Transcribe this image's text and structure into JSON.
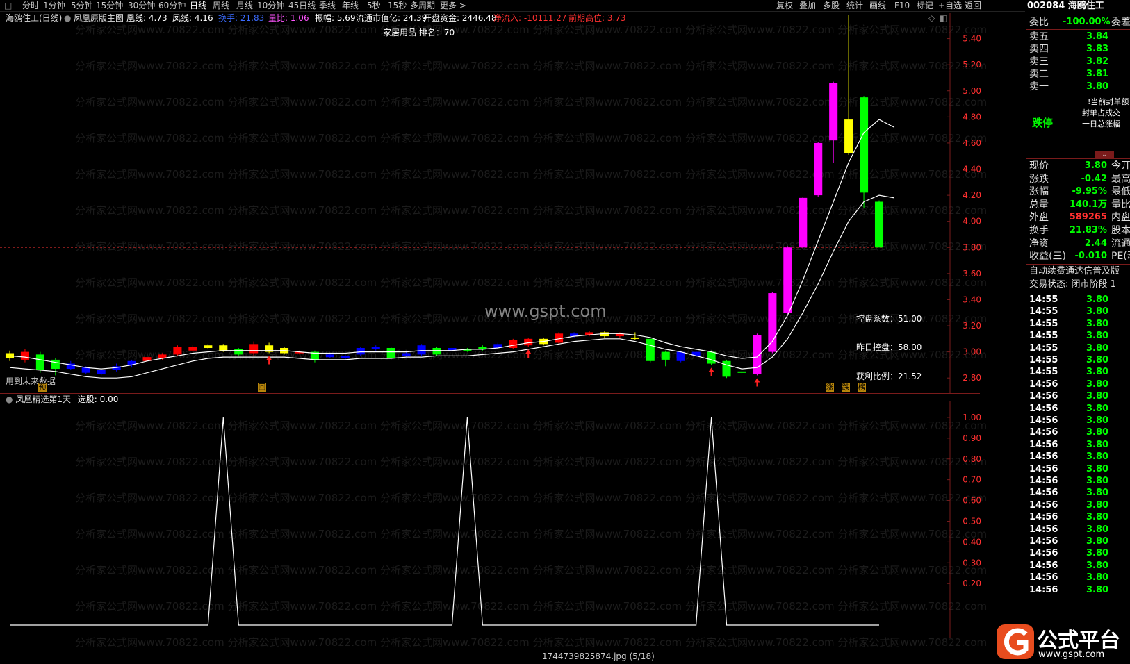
{
  "menubar": {
    "items": [
      "分时",
      "1分钟",
      "5分钟",
      "15分钟",
      "30分钟",
      "60分钟",
      "日线",
      "周线",
      "月线",
      "10分钟",
      "45日线",
      "季线",
      "年线",
      "5秒",
      "15秒",
      "多周期",
      "更多 >"
    ],
    "active_index": 6,
    "right_items": [
      "复权",
      "叠加",
      "多股",
      "统计",
      "画线",
      "F10",
      "标记",
      "+自选",
      "返回"
    ],
    "code_title": "002084 海鸥住工"
  },
  "infobar": {
    "stock_period": "海鸥住工(日线)",
    "indicator_name": "凤凰原版主图",
    "huang_line": "凰线: 4.73",
    "feng_line": "凤线: 4.16",
    "turnover": "换手: 21.83",
    "vol_ratio": "量比: 1.06",
    "amplitude": "振幅: 5.69",
    "float_mv": "流通市值亿: 24.39",
    "open_funds": "开盘资金: 2446.48",
    "net_inflow": "净流入: -10111.27",
    "prev_high": "前期高位: 3.73"
  },
  "main": {
    "sector_rank": "家居用品 排名：70",
    "watermark_row": "分析家公式网www.70822.com 分析家公式网www.70822.com 分析家公式网www.70822.com 分析家公式网www.70822.com 分析家公式网www.70822.com 分析家公式网www.70822.com",
    "watermark_center": "www.gspt.com",
    "control_coef": "控盘系数：51.00",
    "yesterday_control": "昨日控盘：58.00",
    "profit_ratio": "获利比例：21.52",
    "future_data_note": "用到未来数据",
    "marker_yu": "预",
    "marker_hui": "回",
    "marker_zhang": "涨",
    "marker_die": "跌",
    "marker_bang": "榜"
  },
  "sub": {
    "indicator_name": "凤凰精选第1天",
    "select_value": "选股: 0.00"
  },
  "chart_data": [
    {
      "type": "candlestick",
      "title": "",
      "y_ticks": [
        "5.40",
        "5.20",
        "5.00",
        "4.80",
        "4.60",
        "4.40",
        "4.20",
        "4.00",
        "3.80",
        "3.60",
        "3.40",
        "3.20",
        "3.00",
        "2.80"
      ],
      "ylim": [
        2.7,
        5.6
      ],
      "reference_line": 3.8,
      "candles": [
        {
          "o": 2.95,
          "c": 2.99,
          "h": 3.01,
          "l": 2.93,
          "color": "#ffff00"
        },
        {
          "o": 3.0,
          "c": 2.94,
          "h": 3.02,
          "l": 2.92,
          "color": "#ff0000"
        },
        {
          "o": 2.98,
          "c": 2.86,
          "h": 3.0,
          "l": 2.84,
          "color": "#00ff00"
        },
        {
          "o": 2.87,
          "c": 2.94,
          "h": 2.95,
          "l": 2.82,
          "color": "#00ff00"
        },
        {
          "o": 2.91,
          "c": 2.87,
          "h": 2.93,
          "l": 2.86,
          "color": "#0000ff"
        },
        {
          "o": 2.88,
          "c": 2.84,
          "h": 2.89,
          "l": 2.83,
          "color": "#0000ff"
        },
        {
          "o": 2.83,
          "c": 2.86,
          "h": 2.87,
          "l": 2.82,
          "color": "#0000ff"
        },
        {
          "o": 2.86,
          "c": 2.89,
          "h": 2.91,
          "l": 2.85,
          "color": "#0000ff"
        },
        {
          "o": 2.9,
          "c": 2.93,
          "h": 2.94,
          "l": 2.88,
          "color": "#0000ff"
        },
        {
          "o": 2.93,
          "c": 2.96,
          "h": 2.97,
          "l": 2.92,
          "color": "#ff0000"
        },
        {
          "o": 2.95,
          "c": 2.98,
          "h": 2.99,
          "l": 2.94,
          "color": "#ff0000"
        },
        {
          "o": 2.98,
          "c": 3.04,
          "h": 3.05,
          "l": 2.97,
          "color": "#ff0000"
        },
        {
          "o": 3.01,
          "c": 3.04,
          "h": 3.05,
          "l": 3.0,
          "color": "#ff0000"
        },
        {
          "o": 3.03,
          "c": 3.05,
          "h": 3.06,
          "l": 3.02,
          "color": "#ffff00"
        },
        {
          "o": 3.05,
          "c": 3.01,
          "h": 3.06,
          "l": 3.0,
          "color": "#ffff00"
        },
        {
          "o": 3.02,
          "c": 2.98,
          "h": 3.03,
          "l": 2.97,
          "color": "#00ff00"
        },
        {
          "o": 2.99,
          "c": 3.06,
          "h": 3.08,
          "l": 2.97,
          "color": "#ff0000"
        },
        {
          "o": 3.05,
          "c": 3.0,
          "h": 3.07,
          "l": 2.99,
          "color": "#ffff00"
        },
        {
          "o": 3.03,
          "c": 2.99,
          "h": 3.04,
          "l": 2.98,
          "color": "#ffff00"
        },
        {
          "o": 2.99,
          "c": 3.0,
          "h": 3.01,
          "l": 2.98,
          "color": "#ff0000"
        },
        {
          "o": 3.0,
          "c": 2.94,
          "h": 3.01,
          "l": 2.92,
          "color": "#00ff00"
        },
        {
          "o": 2.96,
          "c": 2.98,
          "h": 2.99,
          "l": 2.95,
          "color": "#0000ff"
        },
        {
          "o": 2.97,
          "c": 2.95,
          "h": 2.98,
          "l": 2.94,
          "color": "#0000ff"
        },
        {
          "o": 2.98,
          "c": 3.03,
          "h": 3.04,
          "l": 2.97,
          "color": "#0000ff"
        },
        {
          "o": 3.02,
          "c": 3.04,
          "h": 3.05,
          "l": 3.01,
          "color": "#0000ff"
        },
        {
          "o": 3.03,
          "c": 2.95,
          "h": 3.04,
          "l": 2.94,
          "color": "#00ff00"
        },
        {
          "o": 2.97,
          "c": 2.99,
          "h": 3.0,
          "l": 2.96,
          "color": "#0000ff"
        },
        {
          "o": 2.98,
          "c": 3.05,
          "h": 3.06,
          "l": 2.97,
          "color": "#0000ff"
        },
        {
          "o": 3.03,
          "c": 2.98,
          "h": 3.04,
          "l": 2.97,
          "color": "#00ff00"
        },
        {
          "o": 3.01,
          "c": 3.03,
          "h": 3.04,
          "l": 3.0,
          "color": "#0000ff"
        },
        {
          "o": 3.02,
          "c": 3.01,
          "h": 3.03,
          "l": 3.0,
          "color": "#00ff00"
        },
        {
          "o": 3.02,
          "c": 3.04,
          "h": 3.05,
          "l": 3.01,
          "color": "#00ff00"
        },
        {
          "o": 3.03,
          "c": 3.06,
          "h": 3.07,
          "l": 3.02,
          "color": "#0000ff"
        },
        {
          "o": 3.03,
          "c": 3.09,
          "h": 3.1,
          "l": 3.02,
          "color": "#ff0000"
        },
        {
          "o": 3.05,
          "c": 3.1,
          "h": 3.11,
          "l": 3.04,
          "color": "#ff0000"
        },
        {
          "o": 3.06,
          "c": 3.1,
          "h": 3.11,
          "l": 3.05,
          "color": "#ffff00"
        },
        {
          "o": 3.07,
          "c": 3.14,
          "h": 3.15,
          "l": 3.06,
          "color": "#ff0000"
        },
        {
          "o": 3.12,
          "c": 3.14,
          "h": 3.15,
          "l": 3.11,
          "color": "#0000ff"
        },
        {
          "o": 3.13,
          "c": 3.15,
          "h": 3.16,
          "l": 3.12,
          "color": "#ff0000"
        },
        {
          "o": 3.15,
          "c": 3.12,
          "h": 3.16,
          "l": 3.11,
          "color": "#ffff00"
        },
        {
          "o": 3.12,
          "c": 3.14,
          "h": 3.15,
          "l": 3.11,
          "color": "#ff0000"
        },
        {
          "o": 3.1,
          "c": 3.11,
          "h": 3.15,
          "l": 3.09,
          "color": "#ffff00"
        },
        {
          "o": 3.1,
          "c": 2.93,
          "h": 3.11,
          "l": 2.92,
          "color": "#00ff00"
        },
        {
          "o": 3.0,
          "c": 2.94,
          "h": 3.01,
          "l": 2.89,
          "color": "#00ff00"
        },
        {
          "o": 3.0,
          "c": 2.93,
          "h": 3.01,
          "l": 2.92,
          "color": "#0000ff"
        },
        {
          "o": 2.97,
          "c": 3.0,
          "h": 3.01,
          "l": 2.96,
          "color": "#0000ff"
        },
        {
          "o": 3.0,
          "c": 2.91,
          "h": 3.01,
          "l": 2.9,
          "color": "#00ff00"
        },
        {
          "o": 2.93,
          "c": 2.81,
          "h": 2.94,
          "l": 2.8,
          "color": "#00ff00"
        },
        {
          "o": 2.85,
          "c": 2.84,
          "h": 2.86,
          "l": 2.83,
          "color": "#00ff00"
        },
        {
          "o": 2.83,
          "c": 3.13,
          "h": 3.14,
          "l": 2.82,
          "color": "#ff00ff"
        },
        {
          "o": 3.0,
          "c": 3.45,
          "h": 3.46,
          "l": 2.99,
          "color": "#ff00ff"
        },
        {
          "o": 3.3,
          "c": 3.8,
          "h": 3.81,
          "l": 3.29,
          "color": "#ff00ff"
        },
        {
          "o": 3.8,
          "c": 4.18,
          "h": 4.19,
          "l": 3.79,
          "color": "#ff00ff"
        },
        {
          "o": 4.2,
          "c": 4.6,
          "h": 4.61,
          "l": 4.19,
          "color": "#ff00ff"
        },
        {
          "o": 4.62,
          "c": 5.06,
          "h": 5.07,
          "l": 4.45,
          "color": "#ff00ff"
        },
        {
          "o": 4.78,
          "c": 4.52,
          "h": 5.58,
          "l": 4.51,
          "color": "#ffff00"
        },
        {
          "o": 4.95,
          "c": 4.22,
          "h": 4.96,
          "l": 4.1,
          "color": "#00ff00"
        },
        {
          "o": 4.15,
          "c": 3.8,
          "h": 4.16,
          "l": 3.8,
          "color": "#00ff00"
        }
      ],
      "huang_series": [
        2.97,
        2.96,
        2.94,
        2.92,
        2.9,
        2.88,
        2.87,
        2.88,
        2.9,
        2.93,
        2.95,
        2.97,
        2.99,
        3.0,
        3.01,
        3.01,
        3.01,
        3.01,
        3.01,
        3.0,
        2.99,
        2.99,
        2.99,
        3.0,
        3.0,
        3.0,
        3.0,
        3.01,
        3.01,
        3.01,
        3.02,
        3.02,
        3.03,
        3.05,
        3.07,
        3.08,
        3.1,
        3.12,
        3.13,
        3.14,
        3.14,
        3.13,
        3.11,
        3.07,
        3.04,
        3.02,
        3.0,
        2.97,
        2.95,
        2.96,
        3.08,
        3.28,
        3.55,
        3.85,
        4.15,
        4.45,
        4.68,
        4.78,
        4.72
      ],
      "feng_series": [
        2.88,
        2.87,
        2.86,
        2.85,
        2.83,
        2.81,
        2.8,
        2.8,
        2.81,
        2.84,
        2.87,
        2.9,
        2.93,
        2.95,
        2.96,
        2.96,
        2.96,
        2.96,
        2.96,
        2.95,
        2.94,
        2.94,
        2.94,
        2.95,
        2.95,
        2.95,
        2.96,
        2.96,
        2.97,
        2.97,
        2.97,
        2.98,
        2.99,
        3.0,
        3.02,
        3.04,
        3.06,
        3.08,
        3.09,
        3.1,
        3.1,
        3.08,
        3.05,
        3.02,
        3.0,
        2.97,
        2.94,
        2.9,
        2.87,
        2.88,
        2.96,
        3.1,
        3.3,
        3.52,
        3.77,
        4.0,
        4.15,
        4.2,
        4.18
      ]
    },
    {
      "type": "line",
      "title": "",
      "y_ticks": [
        "1.00",
        "0.90",
        "0.80",
        "0.70",
        "0.60",
        "0.50",
        "0.40",
        "0.30",
        "0.20"
      ],
      "ylim": [
        0.0,
        1.05
      ],
      "peaks_at_candle_index": [
        14,
        30,
        46
      ]
    }
  ],
  "right_panel": {
    "weibi_label": "委比",
    "weibi_val": "-100.00%",
    "weicha_label": "委差",
    "asks": [
      {
        "label": "卖五",
        "price": "3.84"
      },
      {
        "label": "卖四",
        "price": "3.83"
      },
      {
        "label": "卖三",
        "price": "3.82"
      },
      {
        "label": "卖二",
        "price": "3.81"
      },
      {
        "label": "卖一",
        "price": "3.80"
      }
    ],
    "limit_status": "跌停",
    "seal_amount": "当前封单额",
    "seal_ratio": "封单占成交",
    "ten_day_change": "十日总涨幅",
    "quotes": [
      {
        "label": "现价",
        "val": "3.80",
        "label2": "今开"
      },
      {
        "label": "涨跌",
        "val": "-0.42",
        "label2": "最高"
      },
      {
        "label": "涨幅",
        "val": "-9.95%",
        "label2": "最低"
      },
      {
        "label": "总量",
        "val": "140.1万",
        "label2": "量比"
      },
      {
        "label": "外盘",
        "val": "589265",
        "label2": "内盘"
      },
      {
        "label": "换手",
        "val": "21.83%",
        "label2": "股本"
      },
      {
        "label": "净资",
        "val": "2.44",
        "label2": "流通"
      },
      {
        "label": "收益(三)",
        "val": "-0.010",
        "label2": "PE(动"
      }
    ],
    "notice": "自动续费通达信普及版",
    "trade_status": "交易状态: 闭市阶段 1",
    "ticks": [
      {
        "t": "14:55",
        "p": "3.80"
      },
      {
        "t": "14:55",
        "p": "3.80"
      },
      {
        "t": "14:55",
        "p": "3.80"
      },
      {
        "t": "14:55",
        "p": "3.80"
      },
      {
        "t": "14:55",
        "p": "3.80"
      },
      {
        "t": "14:55",
        "p": "3.80"
      },
      {
        "t": "14:55",
        "p": "3.80"
      },
      {
        "t": "14:56",
        "p": "3.80"
      },
      {
        "t": "14:56",
        "p": "3.80"
      },
      {
        "t": "14:56",
        "p": "3.80"
      },
      {
        "t": "14:56",
        "p": "3.80"
      },
      {
        "t": "14:56",
        "p": "3.80"
      },
      {
        "t": "14:56",
        "p": "3.80"
      },
      {
        "t": "14:56",
        "p": "3.80"
      },
      {
        "t": "14:56",
        "p": "3.80"
      },
      {
        "t": "14:56",
        "p": "3.80"
      },
      {
        "t": "14:56",
        "p": "3.80"
      },
      {
        "t": "14:56",
        "p": "3.80"
      },
      {
        "t": "14:56",
        "p": "3.80"
      },
      {
        "t": "14:56",
        "p": "3.80"
      },
      {
        "t": "14:56",
        "p": "3.80"
      },
      {
        "t": "14:56",
        "p": "3.80"
      },
      {
        "t": "14:56",
        "p": "3.80"
      },
      {
        "t": "14:56",
        "p": "3.80"
      },
      {
        "t": "14:56",
        "p": "3.80"
      }
    ]
  },
  "footer": {
    "filename": "1744739825874.jpg (5/18)",
    "logo_text": "公式平台",
    "logo_url": "www.gspt.com"
  },
  "colors": {
    "up": "#ff0000",
    "down": "#00ff00",
    "axis": "#7a1b1b",
    "magenta": "#ff00ff"
  }
}
